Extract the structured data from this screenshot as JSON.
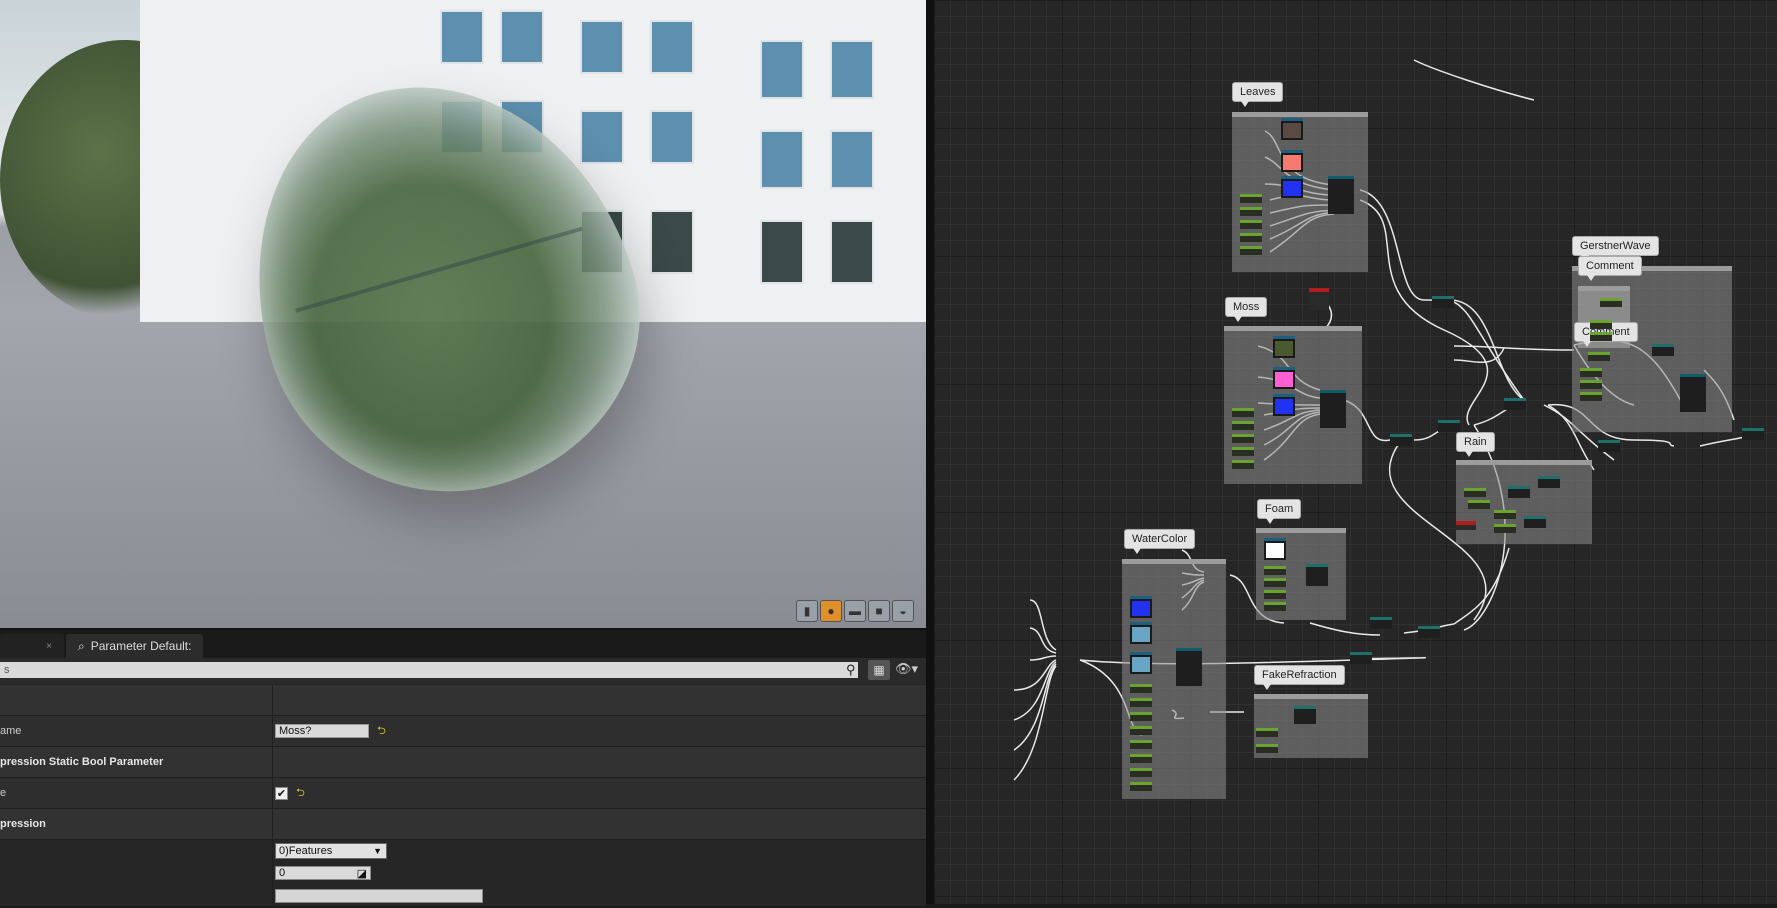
{
  "viewport": {
    "buttons": [
      "cylinder-icon",
      "sphere-icon",
      "plane-icon",
      "cube-icon",
      "teapot-icon"
    ],
    "active_button": "sphere-icon"
  },
  "details_panel": {
    "tabs": [
      {
        "label": "",
        "closable": true
      },
      {
        "label": "Parameter Default:",
        "icon": "search-icon"
      }
    ],
    "search_value": "s",
    "rows": [
      {
        "type": "blank",
        "name": ""
      },
      {
        "type": "text",
        "name": "ame",
        "value": "Moss?"
      },
      {
        "type": "category",
        "name": "pression Static Bool Parameter"
      },
      {
        "type": "checkbox",
        "name": "e",
        "checked": true
      },
      {
        "type": "category",
        "name": "pression"
      },
      {
        "type": "select",
        "value": "0)Features"
      },
      {
        "type": "number",
        "value": "0"
      },
      {
        "type": "bar",
        "value": ""
      }
    ]
  },
  "graph": {
    "comments": [
      {
        "label": "Leaves"
      },
      {
        "label": "Moss"
      },
      {
        "label": "GerstnerWave"
      },
      {
        "label": "Comment"
      },
      {
        "label": "Comment"
      },
      {
        "label": "Rain"
      },
      {
        "label": "Foam"
      },
      {
        "label": "WaterColor"
      },
      {
        "label": "FakeRefraction"
      }
    ],
    "colors": {
      "leaves_swatch_1": "#5a4a44",
      "leaves_swatch_2": "#f47a72",
      "moss_swatch_1": "#4a5a2e",
      "moss_swatch_2": "#ff5fd2",
      "blue_texture": "#2132f0",
      "foam_swatch": "#ffffff",
      "water_swatch": "#69a5c4",
      "param_green": "#6aa32f"
    }
  }
}
